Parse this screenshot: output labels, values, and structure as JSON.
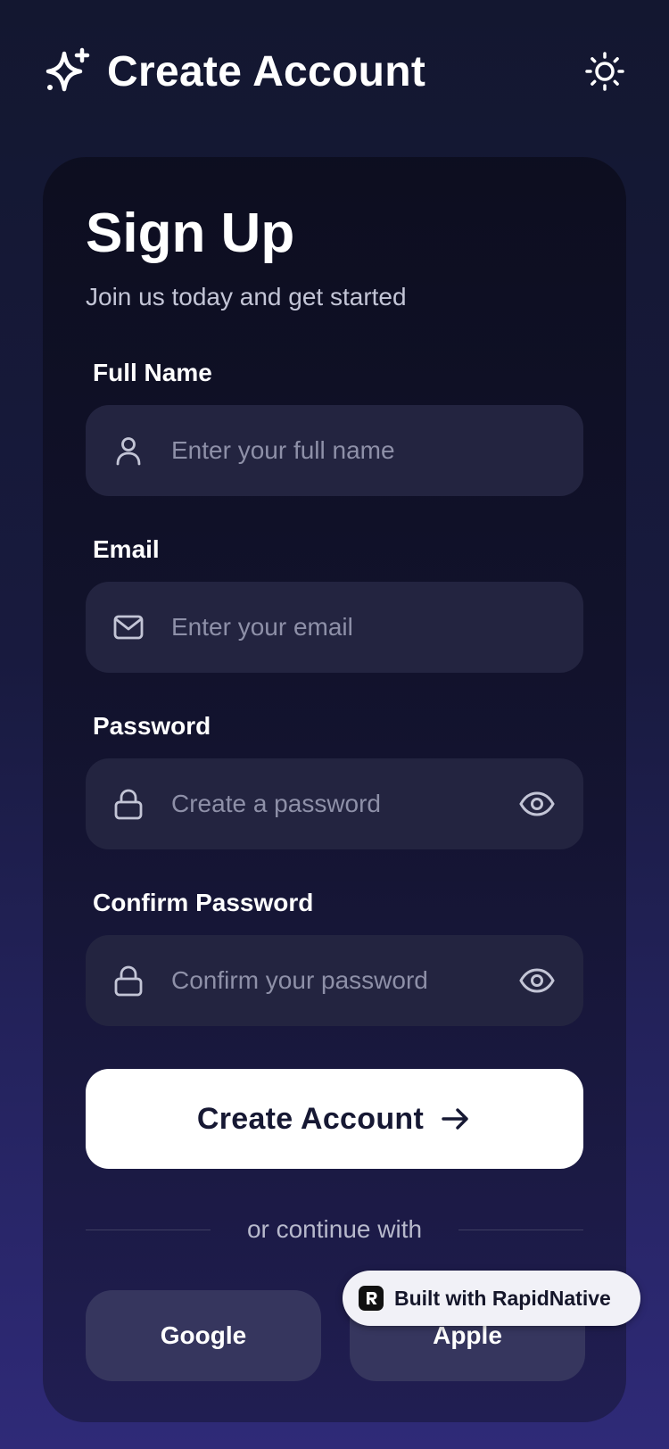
{
  "header": {
    "title": "Create Account",
    "logo_icon": "sparkle-icon",
    "theme_toggle_icon": "sun-icon"
  },
  "card": {
    "title": "Sign Up",
    "subtitle": "Join us today and get started"
  },
  "form": {
    "full_name": {
      "label": "Full Name",
      "placeholder": "Enter your full name",
      "value": "",
      "icon": "user-icon"
    },
    "email": {
      "label": "Email",
      "placeholder": "Enter your email",
      "value": "",
      "icon": "mail-icon"
    },
    "password": {
      "label": "Password",
      "placeholder": "Create a password",
      "value": "",
      "icon": "lock-icon",
      "toggle_icon": "eye-icon"
    },
    "confirm_password": {
      "label": "Confirm Password",
      "placeholder": "Confirm your password",
      "value": "",
      "icon": "lock-icon",
      "toggle_icon": "eye-icon"
    },
    "submit_label": "Create Account",
    "submit_icon": "arrow-right-icon"
  },
  "social": {
    "divider_text": "or continue with",
    "google_label": "Google",
    "apple_label": "Apple"
  },
  "badge": {
    "text": "Built with RapidNative"
  },
  "colors": {
    "background_top": "#131730",
    "background_bottom": "#2f2a78",
    "input_background": "#232440",
    "social_button": "#36365e",
    "primary_button": "#ffffff",
    "placeholder": "#8e90a8"
  }
}
